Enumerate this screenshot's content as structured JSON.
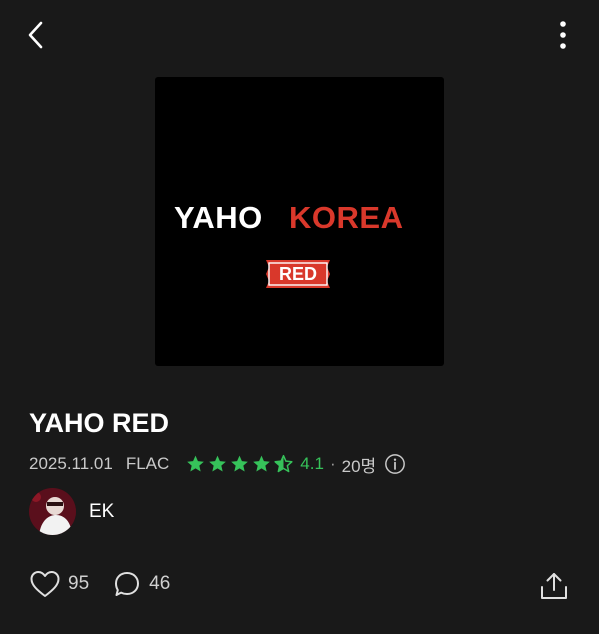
{
  "header": {
    "back_icon": "chevron-left-icon",
    "more_icon": "more-vertical-icon"
  },
  "album": {
    "cover": {
      "word1": "YAHO",
      "word2": "KOREA",
      "badge": "RED",
      "word1_color": "#ffffff",
      "word2_color": "#d9382b",
      "badge_color": "#d9382b",
      "background": "#000000"
    },
    "title": "YAHO RED",
    "date": "2025.11.01",
    "format": "FLAC",
    "rating_value": 4.1,
    "rating_label": "4.1",
    "rating_separator": "·",
    "rating_count": "20명",
    "rating_color": "#36c25a",
    "star_icon": "star-icon",
    "info_icon": "info-icon"
  },
  "artist": {
    "name": "EK",
    "avatar_icon": "artist-avatar"
  },
  "actions": {
    "like_icon": "heart-icon",
    "like_count": "95",
    "comment_icon": "comment-icon",
    "comment_count": "46",
    "share_icon": "share-icon"
  }
}
